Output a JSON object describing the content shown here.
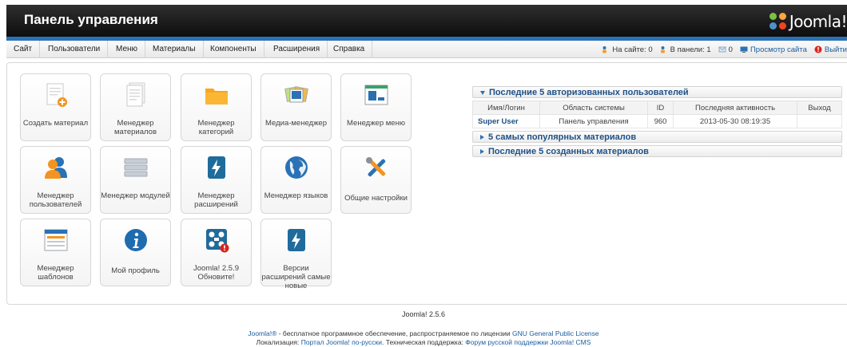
{
  "header": {
    "title": "Панель управления",
    "logo_text": "Joomla!"
  },
  "menu": {
    "items": [
      "Сайт",
      "Пользователи",
      "Меню",
      "Материалы",
      "Компоненты",
      "Расширения",
      "Справка"
    ]
  },
  "status": {
    "on_site": "На сайте: 0",
    "in_panel": "В панели: 1",
    "messages": "0",
    "view_site": "Просмотр сайта",
    "logout": "Выйти"
  },
  "tiles": [
    {
      "label": "Создать материал",
      "icon": "new-article-icon"
    },
    {
      "label": "Менеджер материалов",
      "icon": "articles-icon"
    },
    {
      "label": "Менеджер категорий",
      "icon": "folder-icon"
    },
    {
      "label": "Медиа-менеджер",
      "icon": "media-icon"
    },
    {
      "label": "Менеджер меню",
      "icon": "menu-manager-icon"
    },
    {
      "label": "Менеджер пользователей",
      "icon": "users-icon"
    },
    {
      "label": "Менеджер модулей",
      "icon": "modules-icon"
    },
    {
      "label": "Менеджер расширений",
      "icon": "extensions-icon"
    },
    {
      "label": "Менеджер языков",
      "icon": "globe-icon"
    },
    {
      "label": "Общие настройки",
      "icon": "tools-icon"
    },
    {
      "label": "Менеджер шаблонов",
      "icon": "templates-icon"
    },
    {
      "label": "Мой профиль",
      "icon": "info-icon"
    },
    {
      "label": "Joomla! 2.5.9 Обновите!",
      "icon": "joomla-update-icon"
    },
    {
      "label": "Версии расширений самые новые",
      "icon": "extension-update-icon"
    }
  ],
  "widgets": {
    "logged_users_title": "Последние 5 авторизованных пользователей",
    "columns": [
      "Имя/Логин",
      "Область системы",
      "ID",
      "Последняя активность",
      "Выход"
    ],
    "rows": [
      {
        "name": "Super User",
        "area": "Панель управления",
        "id": "960",
        "last": "2013-05-30 08:19:35",
        "logout": ""
      }
    ],
    "popular_title": "5 самых популярных материалов",
    "created_title": "Последние 5 созданных материалов"
  },
  "footer": {
    "version": "Joomla! 2.5.6",
    "line1_a": "Joomla!®",
    "line1_b": " - бесплатное программное обеспечение, распространяемое по лицензии ",
    "line1_c": "GNU General Public License",
    "line2_a": "Локализация: ",
    "line2_b": "Портал Joomla! по-русски",
    "line2_c": ". Техническая поддержка: ",
    "line2_d": "Форум русской поддержки Joomla! CMS"
  },
  "colors": {
    "accent": "#2a72b5",
    "header_bg": "#1a1a1a",
    "link": "#1a5c9e"
  }
}
